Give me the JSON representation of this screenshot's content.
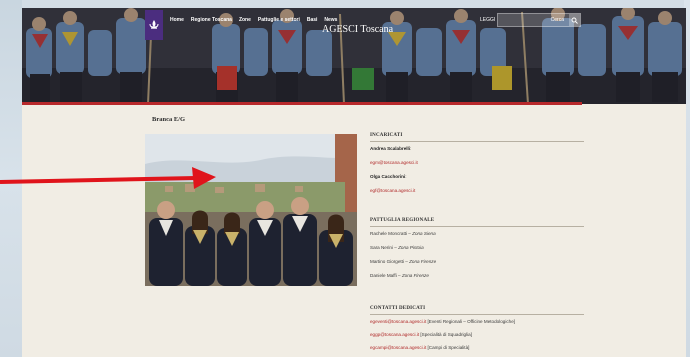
{
  "header": {
    "site_title": "AGESCI Toscana",
    "nav": [
      "Home",
      "Regione Toscana",
      "Zone",
      "Pattuglie e settori",
      "Basi",
      "News"
    ],
    "lang": "LEGGI",
    "search_placeholder": "Cerca"
  },
  "page": {
    "heading": "Branca E/G"
  },
  "incaricati": {
    "title": "INCARICATI",
    "persons": [
      {
        "name": "Andrea Scalabrelli",
        "email": "egm@toscana.agesci.it"
      },
      {
        "name": "Olga Cacchorini",
        "email": "egf@toscana.agesci.it"
      }
    ]
  },
  "pattuglia": {
    "title": "PATTUGLIA REGIONALE",
    "members": [
      {
        "name": "Rachele Moncratti",
        "zone": "Zona Siena"
      },
      {
        "name": "Sara Nerini",
        "zone": "Zona Pistoia"
      },
      {
        "name": "Martino Giorgetti",
        "zone": "Zona Firenze"
      },
      {
        "name": "Daniele Maffi",
        "zone": "Zona Firenze"
      }
    ]
  },
  "contatti": {
    "title": "CONTATTI DEDICATI",
    "items": [
      {
        "email": "egeventi@toscana.agesci.it",
        "desc": "[Eventi Regionali – Officine Metodologiche]"
      },
      {
        "email": "eggp@toscana.agesci.it",
        "desc": "[Specialità di Squadriglia]"
      },
      {
        "email": "egcampi@toscana.agesci.it",
        "desc": "[Campi di Specialità]"
      }
    ]
  },
  "colors": {
    "accent_red": "#b8292c",
    "link": "#b02a2a",
    "logo_purple": "#4b2d7f",
    "page_bg": "#f1ede4",
    "arrow": "#e0141b"
  }
}
